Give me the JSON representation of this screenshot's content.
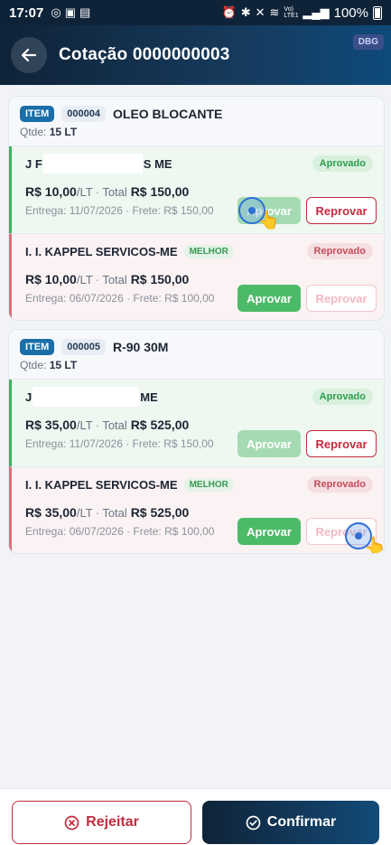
{
  "status_bar": {
    "time": "17:07",
    "battery": "100%",
    "network": "Vo) LTE1"
  },
  "header": {
    "title": "Cotação 0000000003",
    "debug_badge": "DBG"
  },
  "items": [
    {
      "item_label": "ITEM",
      "code": "000004",
      "name": "OLEO BLOCANTE",
      "qty_label": "Qtde:",
      "qty_value": "15 LT",
      "suppliers": [
        {
          "name_start": "J F",
          "name_end": "S ME",
          "status": "Aprovado",
          "unit_price": "R$ 10,00",
          "unit": "/LT",
          "total_label": "Total",
          "total": "R$ 150,00",
          "delivery": "Entrega: 11/07/2026 · Frete: R$ 150,00",
          "approve_label": "Aprovar",
          "reject_label": "Reprovar"
        },
        {
          "name": "I. I. KAPPEL SERVICOS-ME",
          "badge": "MELHOR",
          "status": "Reprovado",
          "unit_price": "R$ 10,00",
          "unit": "/LT",
          "total_label": "Total",
          "total": "R$ 150,00",
          "delivery": "Entrega: 06/07/2026 · Frete: R$ 100,00",
          "approve_label": "Aprovar",
          "reject_label": "Reprovar"
        }
      ]
    },
    {
      "item_label": "ITEM",
      "code": "000005",
      "name": "R-90 30M",
      "qty_label": "Qtde:",
      "qty_value": "15 LT",
      "suppliers": [
        {
          "name_start": "J",
          "name_end": "ME",
          "status": "Aprovado",
          "unit_price": "R$ 35,00",
          "unit": "/LT",
          "total_label": "Total",
          "total": "R$ 525,00",
          "delivery": "Entrega: 11/07/2026 · Frete: R$ 150,00",
          "approve_label": "Aprovar",
          "reject_label": "Reprovar"
        },
        {
          "name": "I. I. KAPPEL SERVICOS-ME",
          "badge": "MELHOR",
          "status": "Reprovado",
          "unit_price": "R$ 35,00",
          "unit": "/LT",
          "total_label": "Total",
          "total": "R$ 525,00",
          "delivery": "Entrega: 06/07/2026 · Frete: R$ 100,00",
          "approve_label": "Aprovar",
          "reject_label": "Reprovar"
        }
      ]
    }
  ],
  "footer": {
    "reject_label": "Rejeitar",
    "confirm_label": "Confirmar"
  },
  "colors": {
    "header_dark": "#0f2338",
    "approve_green": "#4cbb68",
    "reject_red": "#c42b3f"
  }
}
